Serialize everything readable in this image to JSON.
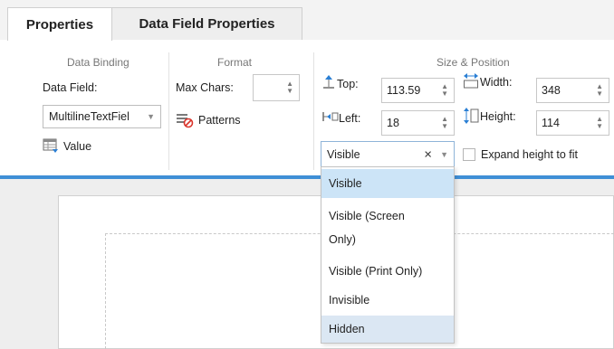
{
  "tabs": [
    {
      "label": "Properties",
      "active": true
    },
    {
      "label": "Data Field Properties",
      "active": false
    }
  ],
  "data_binding": {
    "title": "Data Binding",
    "data_field_label": "Data Field:",
    "data_field_value": "MultilineTextFiel",
    "value_label": "Value"
  },
  "format": {
    "title": "Format",
    "max_chars_label": "Max Chars:",
    "max_chars_value": "",
    "patterns_label": "Patterns"
  },
  "size_position": {
    "title": "Size & Position",
    "top_label": "Top:",
    "top_value": "113.59",
    "left_label": "Left:",
    "left_value": "18",
    "width_label": "Width:",
    "width_value": "348",
    "height_label": "Height:",
    "height_value": "114",
    "visibility_value": "Visible",
    "clear_glyph": "×",
    "expand_label": "Expand height to fit",
    "expand_checked": false
  },
  "visibility_options": [
    {
      "label": "Visible",
      "selected": true
    },
    {
      "label": "Visible (Screen Only)",
      "line1": "Visible (Screen",
      "line2": "Only)"
    },
    {
      "label": "Visible (Print Only)"
    },
    {
      "label": "Invisible"
    },
    {
      "label": "Hidden",
      "hovered": true
    }
  ],
  "colors": {
    "accent": "#3f8fd6",
    "selected_item": "#cce4f7",
    "hover_item": "#dbe7f3"
  },
  "icons": [
    "value-table-icon",
    "patterns-icon",
    "top-position-icon",
    "left-position-icon",
    "width-icon",
    "height-icon",
    "chevron-down-icon",
    "spinner-icon",
    "clear-icon"
  ]
}
